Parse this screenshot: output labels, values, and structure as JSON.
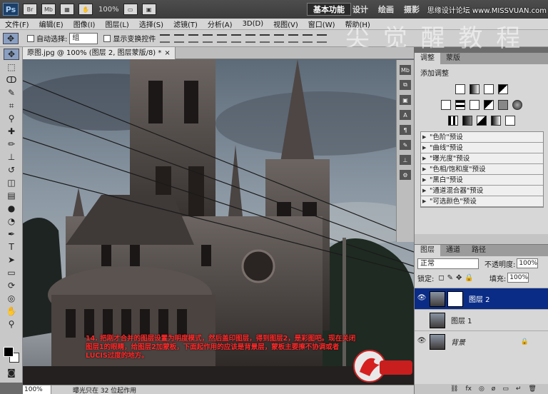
{
  "appbar": {
    "logo": "Ps",
    "buttons": [
      "Br",
      "Mb"
    ],
    "zoom": "100%",
    "workspaces": [
      "基本功能",
      "设计",
      "绘画",
      "摄影"
    ],
    "watermark": "思缘设计论坛 www.MISSVUAN.com"
  },
  "menu": [
    "文件(F)",
    "编辑(E)",
    "图像(I)",
    "图层(L)",
    "选择(S)",
    "滤镜(T)",
    "分析(A)",
    "3D(D)",
    "视图(V)",
    "窗口(W)",
    "帮助(H)"
  ],
  "options": {
    "auto_select_label": "自动选择:",
    "auto_select_value": "组",
    "transform_label": "显示变换控件"
  },
  "bg_watermark": "尖 觉 醒 教 程",
  "document": {
    "tab_title": "原图.jpg @ 100% (图层 2, 图层蒙版/8) *",
    "close": "×"
  },
  "caption": "14. 把刚才合并的图层设置为明度模式，然后盖印图层，得到图层2，是彩图吧。现在关闭图层1的眼睛，给图层2加蒙板，下面起作用的应该是背景层，蒙板主要擦不协调或者LUCIS过度的地方。",
  "status": {
    "zoom": "100%",
    "info": "曝光只在 32 位起作用"
  },
  "adjustments": {
    "tabs": [
      "调整",
      "蒙版"
    ],
    "title": "添加调整",
    "presets": [
      "\"色阶\"预设",
      "\"曲线\"预设",
      "\"曝光度\"预设",
      "\"色相/饱和度\"预设",
      "\"黑白\"预设",
      "\"通道混合器\"预设",
      "\"可选颜色\"预设"
    ]
  },
  "layers": {
    "tabs": [
      "图层",
      "通道",
      "路径"
    ],
    "blend_mode": "正常",
    "opacity_label": "不透明度:",
    "opacity": "100%",
    "lock_label": "锁定:",
    "fill_label": "填充:",
    "fill": "100%",
    "items": [
      {
        "name": "图层 2",
        "selected": true,
        "visible": true,
        "mask": true
      },
      {
        "name": "图层 1",
        "selected": false,
        "visible": false,
        "mask": false
      },
      {
        "name": "背景",
        "selected": false,
        "visible": true,
        "mask": false,
        "locked": true
      }
    ],
    "bottom_icons": [
      "fx",
      "◎",
      "ø",
      "▭",
      "↵",
      "🗑"
    ]
  },
  "logo_stamp": "火列鸟"
}
